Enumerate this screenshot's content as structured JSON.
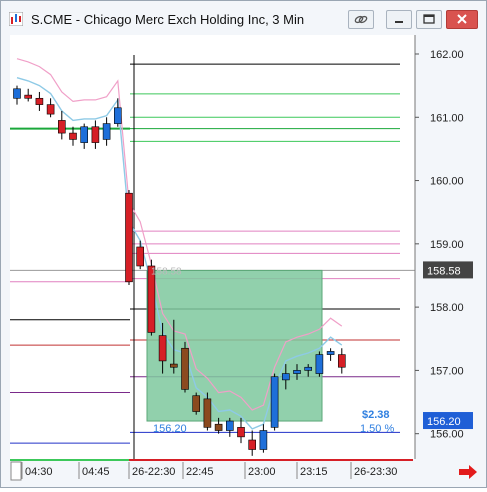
{
  "window": {
    "title": "S.CME - Chicago Merc Exch Holding Inc, 3 Min",
    "buttons": [
      "link",
      "minimize",
      "maximize",
      "close"
    ]
  },
  "chart": {
    "price_labels": [
      "162.00",
      "161.00",
      "160.00",
      "159.00",
      "158.00",
      "157.00",
      "156.00"
    ],
    "price_values": [
      162,
      161,
      160,
      159,
      158,
      157,
      156
    ],
    "current_price_label": "158.58",
    "current_price": 158.58,
    "stop_price_label": "156.20",
    "stop_price": 156.2,
    "overlay_price_label": "158.58",
    "trade_entry_label": "156.20",
    "trade_pnl_label": "$2.38",
    "trade_pct_label": "1.50 %",
    "time_labels": [
      "04:30",
      "04:45",
      "26-22:30",
      "22:45",
      "23:00",
      "23:15",
      "26-23:30"
    ],
    "colors": {
      "up_candle": "#1e6fd9",
      "down_candle": "#d61f26",
      "down_candle_brown": "#8b4a1f",
      "trade_box": "#7ec89d",
      "axis_marker_dark": "#444444",
      "axis_marker_blue": "#1f5fd6",
      "stop_line": "#2030c8",
      "label_blue": "#2f7fe0"
    },
    "icons": [
      "app-icon",
      "link-icon",
      "minimize-icon",
      "maximize-icon",
      "close-icon",
      "scroll-right-arrow-icon"
    ]
  },
  "chart_data": {
    "type": "candlestick",
    "ylim": [
      155.6,
      162.3
    ],
    "candles": [
      {
        "o": 161.3,
        "h": 161.5,
        "l": 161.2,
        "c": 161.45
      },
      {
        "o": 161.35,
        "h": 161.45,
        "l": 161.25,
        "c": 161.3
      },
      {
        "o": 161.3,
        "h": 161.4,
        "l": 161.1,
        "c": 161.2
      },
      {
        "o": 161.2,
        "h": 161.3,
        "l": 161.0,
        "c": 161.05
      },
      {
        "o": 160.95,
        "h": 161.1,
        "l": 160.65,
        "c": 160.75
      },
      {
        "o": 160.75,
        "h": 160.85,
        "l": 160.55,
        "c": 160.65
      },
      {
        "o": 160.6,
        "h": 160.9,
        "l": 160.5,
        "c": 160.85
      },
      {
        "o": 160.85,
        "h": 160.95,
        "l": 160.5,
        "c": 160.6
      },
      {
        "o": 160.65,
        "h": 161.0,
        "l": 160.55,
        "c": 160.9
      },
      {
        "o": 160.9,
        "h": 161.3,
        "l": 160.85,
        "c": 161.15
      },
      {
        "o": 159.8,
        "h": 159.85,
        "l": 158.35,
        "c": 158.4
      },
      {
        "o": 158.95,
        "h": 159.05,
        "l": 158.6,
        "c": 158.65
      },
      {
        "o": 158.65,
        "h": 158.75,
        "l": 157.55,
        "c": 157.6
      },
      {
        "o": 157.55,
        "h": 157.75,
        "l": 156.95,
        "c": 157.15
      },
      {
        "o": 157.1,
        "h": 157.8,
        "l": 156.95,
        "c": 157.05
      },
      {
        "o": 157.35,
        "h": 157.45,
        "l": 156.65,
        "c": 156.7
      },
      {
        "o": 156.6,
        "h": 156.65,
        "l": 156.3,
        "c": 156.35
      },
      {
        "o": 156.55,
        "h": 156.65,
        "l": 156.05,
        "c": 156.1
      },
      {
        "o": 156.15,
        "h": 156.25,
        "l": 156.0,
        "c": 156.05
      },
      {
        "o": 156.05,
        "h": 156.25,
        "l": 155.95,
        "c": 156.2
      },
      {
        "o": 156.1,
        "h": 156.25,
        "l": 155.85,
        "c": 155.95
      },
      {
        "o": 155.9,
        "h": 156.05,
        "l": 155.65,
        "c": 155.75
      },
      {
        "o": 155.75,
        "h": 156.15,
        "l": 155.7,
        "c": 156.05
      },
      {
        "o": 156.1,
        "h": 156.95,
        "l": 156.05,
        "c": 156.9
      },
      {
        "o": 156.85,
        "h": 157.1,
        "l": 156.7,
        "c": 156.95
      },
      {
        "o": 156.95,
        "h": 157.1,
        "l": 156.85,
        "c": 157.0
      },
      {
        "o": 157.0,
        "h": 157.1,
        "l": 156.9,
        "c": 157.05
      },
      {
        "o": 156.95,
        "h": 157.3,
        "l": 156.9,
        "c": 157.25
      },
      {
        "o": 157.25,
        "h": 157.35,
        "l": 157.15,
        "c": 157.3
      },
      {
        "o": 157.25,
        "h": 157.35,
        "l": 156.95,
        "c": 157.05
      }
    ]
  }
}
